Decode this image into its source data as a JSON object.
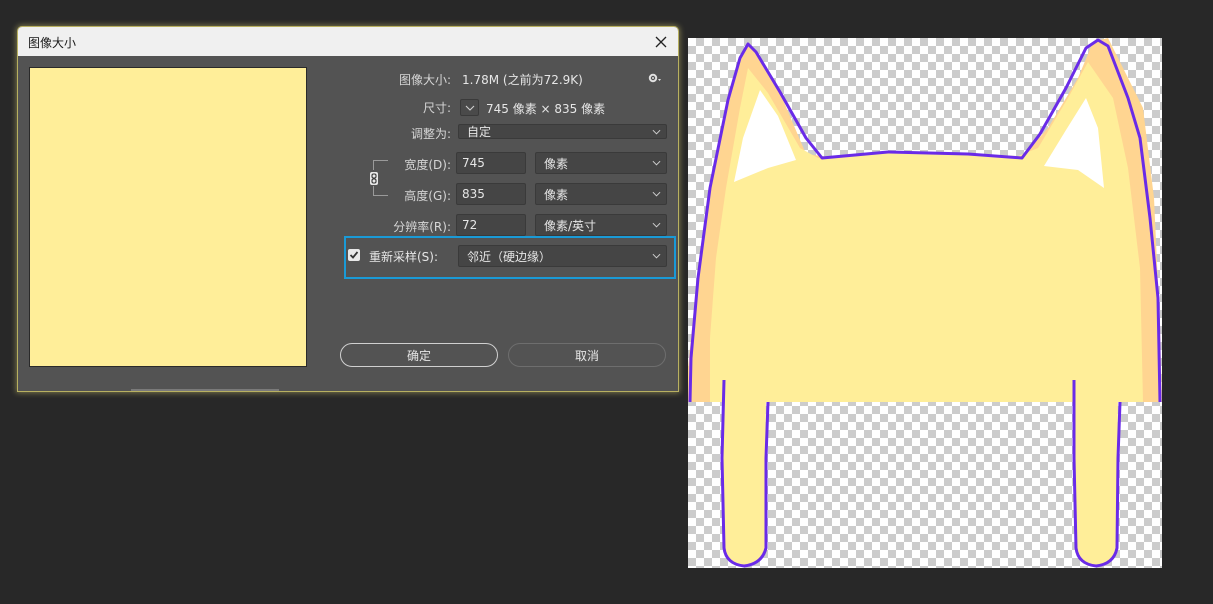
{
  "dialog": {
    "title": "图像大小",
    "image_size_label": "图像大小:",
    "image_size_value": "1.78M (之前为72.9K)",
    "dimensions_label": "尺寸:",
    "dimensions_value": "745 像素 × 835 像素",
    "fit_to_label": "调整为:",
    "fit_to_value": "自定",
    "width_label": "宽度(D):",
    "width_value": "745",
    "width_unit": "像素",
    "height_label": "高度(G):",
    "height_value": "835",
    "height_unit": "像素",
    "resolution_label": "分辨率(R):",
    "resolution_value": "72",
    "resolution_unit": "像素/英寸",
    "resample_label": "重新采样(S):",
    "resample_checked": true,
    "resample_value": "邻近（硬边缘）",
    "ok_label": "确定",
    "cancel_label": "取消"
  },
  "colors": {
    "preview_fill": "#FFEE99",
    "highlight_border": "#1A9AD6",
    "cat_outline": "#6A2BE8",
    "cat_body": "#FFEE99",
    "cat_shade": "#FFD591"
  },
  "icons": {
    "close": "close-icon",
    "gear": "gear-icon",
    "link": "link-icon",
    "chevron": "chevron-down-icon",
    "check": "check-icon"
  }
}
